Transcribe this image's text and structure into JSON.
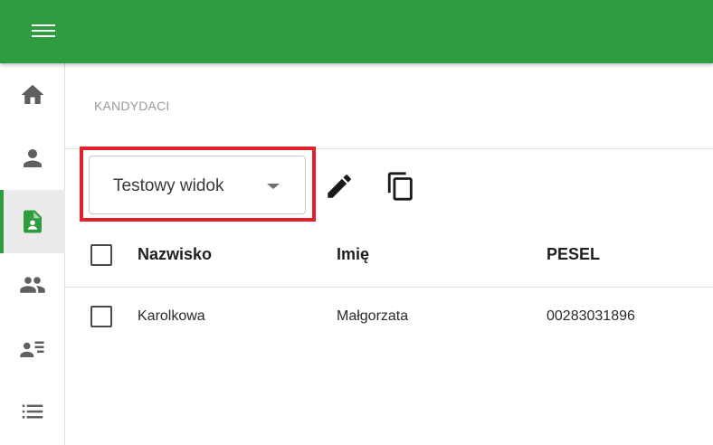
{
  "app": {
    "accent_color": "#2e9c3f"
  },
  "topbar": {
    "menu_icon": "hamburger-menu-icon"
  },
  "sidebar": {
    "items": [
      {
        "icon": "home-icon",
        "active": false
      },
      {
        "icon": "person-icon",
        "active": false
      },
      {
        "icon": "candidate-document-icon",
        "active": true
      },
      {
        "icon": "people-icon",
        "active": false
      },
      {
        "icon": "person-list-icon",
        "active": false
      },
      {
        "icon": "list-icon",
        "active": false
      }
    ]
  },
  "breadcrumb": "KANDYDACI",
  "toolbar": {
    "view_select_value": "Testowy widok",
    "edit_icon": "pencil-icon",
    "copy_icon": "copy-icon"
  },
  "table": {
    "headers": [
      "Nazwisko",
      "Imię",
      "PESEL"
    ],
    "rows": [
      {
        "cells": [
          "Karolkowa",
          "Małgorzata",
          "00283031896"
        ]
      }
    ]
  },
  "highlight_color": "#e3212a"
}
